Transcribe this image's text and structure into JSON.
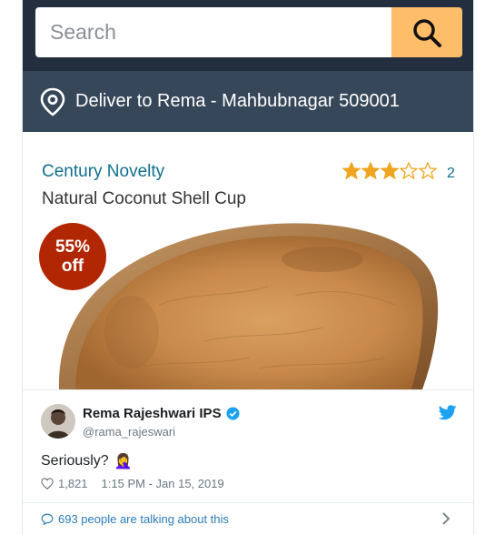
{
  "search": {
    "placeholder": "Search",
    "button_icon": "search-icon"
  },
  "delivery": {
    "icon": "location-pin-icon",
    "text": "Deliver to Rema - Mahbubnagar 509001"
  },
  "product": {
    "brand": "Century Novelty",
    "title": "Natural Coconut Shell Cup",
    "rating": 3,
    "rating_max": 5,
    "review_count": "2",
    "discount_percent": "55%",
    "discount_suffix": "off"
  },
  "tweet": {
    "author_name": "Rema Rajeshwari IPS",
    "handle": "@rama_rajeswari",
    "verified": true,
    "text": "Seriously?",
    "emoji": "🤦‍♀️",
    "likes": "1,821",
    "timestamp": "1:15 PM - Jan 15, 2019",
    "talking": "693 people are talking about this"
  },
  "colors": {
    "search_band": "#232f3e",
    "deliver_band": "#37475a",
    "search_button": "#febd69",
    "star": "#f0a51f",
    "badge": "#b12704",
    "link": "#0f6f8c",
    "twitter_blue": "#1da1f2"
  }
}
